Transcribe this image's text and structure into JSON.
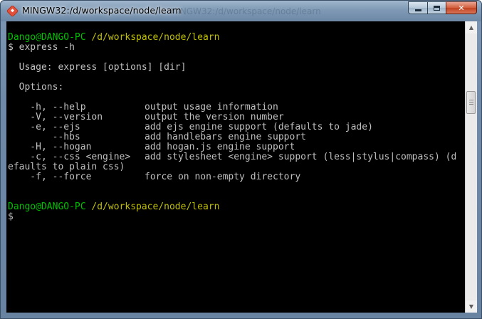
{
  "window": {
    "title": "MINGW32:/d/workspace/node/learn",
    "ghost_title": "MINGW32:/d/workspace/node/learn",
    "app_icon": "git-icon",
    "controls": {
      "minimize": "minimize-icon",
      "maximize": "maximize-icon",
      "close": "✕"
    }
  },
  "terminal": {
    "prompt1": {
      "user": "Dango@DANGO-PC",
      "path": "/d/workspace/node/learn"
    },
    "command": "$ express -h",
    "usage": "  Usage: express [options] [dir]",
    "options_header": "  Options:",
    "options": [
      {
        "flag": "    -h, --help",
        "desc": "output usage information"
      },
      {
        "flag": "    -V, --version",
        "desc": "output the version number"
      },
      {
        "flag": "    -e, --ejs",
        "desc": "add ejs engine support (defaults to jade)"
      },
      {
        "flag": "        --hbs",
        "desc": "add handlebars engine support"
      },
      {
        "flag": "    -H, --hogan",
        "desc": "add hogan.js engine support"
      },
      {
        "flag": "    -c, --css <engine>",
        "desc": "add stylesheet <engine> support (less|stylus|compass) (d"
      }
    ],
    "wrap_line": "efaults to plain css)",
    "force_option": {
      "flag": "    -f, --force",
      "desc": "force on non-empty directory"
    },
    "prompt2": {
      "user": "Dango@DANGO-PC",
      "path": "/d/workspace/node/learn"
    },
    "final_prompt": "$"
  },
  "colors": {
    "prompt_user": "#00c000",
    "prompt_path": "#c0c000",
    "text": "#c0c0c0",
    "background": "#000000"
  }
}
